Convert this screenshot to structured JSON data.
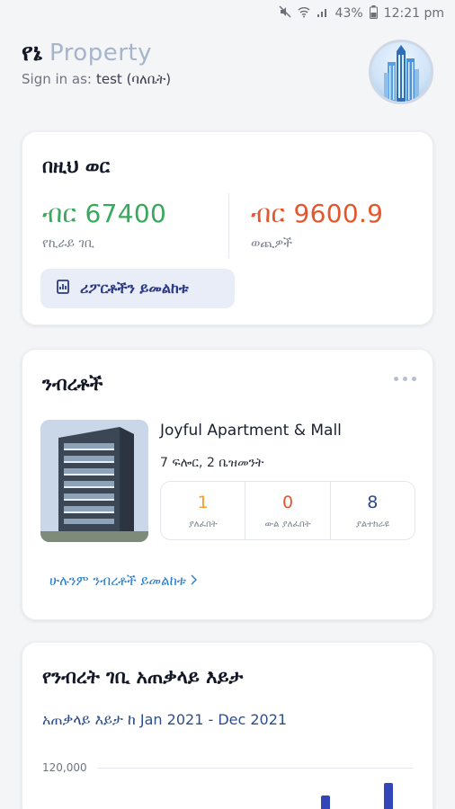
{
  "status_bar": {
    "battery": "43%",
    "time": "12:21 pm"
  },
  "header": {
    "brand_mark": "የኔ",
    "brand_word": "Property",
    "signin_label": "Sign in as:",
    "signin_user": "test (ባለቤት)"
  },
  "month_card": {
    "title": "በዚህ ወር",
    "income_amount": "ብር 67400",
    "income_label": "የኪራይ ገቢ",
    "expense_amount": "ብር 9600.9",
    "expense_label": "ወጪዎች",
    "report_button": "ሪፖርቶችን ይመልከቱ"
  },
  "properties_card": {
    "title": "ንብረቶች",
    "property": {
      "name": "Joyful Apartment & Mall",
      "floors": "7 ፍሎር, 2 ቤዝመንት",
      "stats": [
        {
          "value": "1",
          "label": "ያለፈበት"
        },
        {
          "value": "0",
          "label": "ውል ያለፈበት"
        },
        {
          "value": "8",
          "label": "ያልተከራዩ"
        }
      ]
    },
    "view_all": "ሁሉንም ንብረቶች ይመልከቱ"
  },
  "revenue_card": {
    "title": "የንብረት ገቢ አጠቃላይ እይታ",
    "subtitle": "አጠቃላይ እይታ ከ Jan 2021 - Dec 2021",
    "chart_data": {
      "type": "bar",
      "y_tick_labels": [
        "120,000"
      ],
      "colors": {
        "bar": "#3346b7"
      }
    }
  },
  "colors": {
    "income": "#3aa85e",
    "expense": "#e4572e",
    "accent": "#2a7fd1",
    "brand_light": "#a6b4cc"
  }
}
